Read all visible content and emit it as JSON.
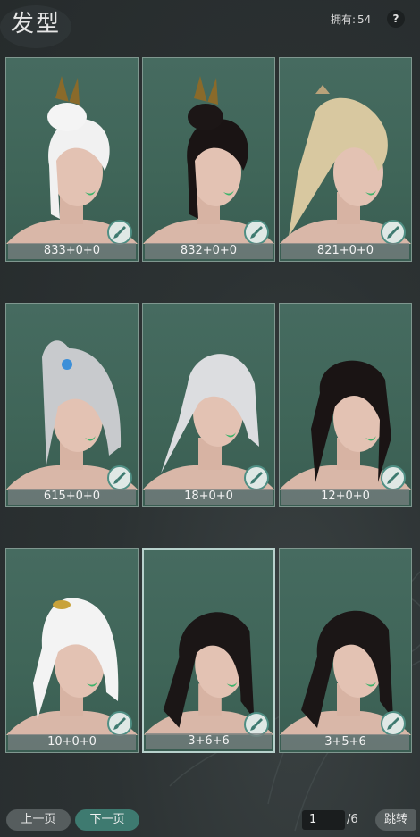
{
  "header": {
    "title": "发型",
    "owned_label": "拥有:",
    "owned_count": "54",
    "help_label": "?"
  },
  "hairstyles": [
    {
      "code": "833+0+0",
      "hair": "white-bun-ornament"
    },
    {
      "code": "832+0+0",
      "hair": "black-bun-ornament"
    },
    {
      "code": "821+0+0",
      "hair": "blonde-ponytail"
    },
    {
      "code": "615+0+0",
      "hair": "silver-high-ponytail"
    },
    {
      "code": "18+0+0",
      "hair": "white-long-flowing"
    },
    {
      "code": "12+0+0",
      "hair": "black-long"
    },
    {
      "code": "10+0+0",
      "hair": "white-high-ponytail"
    },
    {
      "code": "3+6+6",
      "hair": "black-ponytail",
      "selected": true
    },
    {
      "code": "3+5+6",
      "hair": "black-ponytail"
    }
  ],
  "footer": {
    "prev_label": "上一页",
    "next_label": "下一页",
    "page_current": "1",
    "page_total": "/6",
    "jump_label": "跳转"
  },
  "colors": {
    "card_bg": "#426a5d",
    "accent_green": "#3e7a70",
    "background": "#2c3233"
  }
}
